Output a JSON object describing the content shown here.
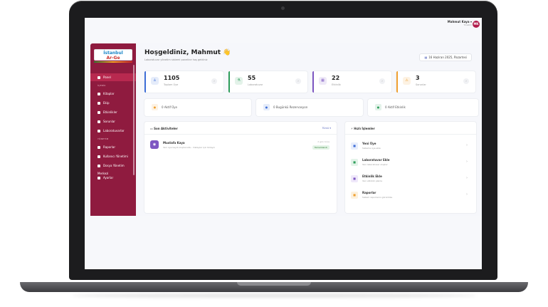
{
  "header": {
    "user_name": "Mahmut Kaya ▾",
    "user_role": "Yönetici",
    "avatar_initials": "MK"
  },
  "sidebar": {
    "logo_line1": "İstanbul",
    "logo_line2": "Ar-Ge",
    "items": [
      {
        "label": "Panel",
        "active": true
      },
      {
        "section": "İÇERİK"
      },
      {
        "label": "Kitaplar"
      },
      {
        "label": "Ekip"
      },
      {
        "label": "Etkinlikler"
      },
      {
        "label": "Sorunlar"
      },
      {
        "label": "Laboratuvarlar"
      },
      {
        "section": "YÖNETİM"
      },
      {
        "label": "Raporlar"
      },
      {
        "label": "Kullanıcı Yönetimi"
      },
      {
        "label": "Dosya Yönetim Merkezi"
      },
      {
        "label": "Ayarlar"
      }
    ]
  },
  "main": {
    "greeting": "Hoşgeldiniz, Mahmut 👋",
    "greeting_sub": "Laboratuvar yönetim sistemi paneline hoş geldiniz",
    "date": "16 Haziran 2025, Pazartesi"
  },
  "stats": [
    {
      "value": "1105",
      "label": "Toplam Üye",
      "color": "#3f6fd8",
      "icon": "user-icon"
    },
    {
      "value": "55",
      "label": "Laboratuvar",
      "color": "#2e9e5b",
      "icon": "lab-icon"
    },
    {
      "value": "22",
      "label": "Etkinlik",
      "color": "#7e57c2",
      "icon": "calendar-icon"
    },
    {
      "value": "3",
      "label": "Sorunlar",
      "color": "#f0a030",
      "icon": "alert-icon"
    }
  ],
  "quick": [
    {
      "label": "0  Aktif Üye",
      "color": "#f0a030"
    },
    {
      "label": "0  Bugünkü Rezervasyon",
      "color": "#3f6fd8"
    },
    {
      "label": "0  Aktif Etkinlik",
      "color": "#2e9e5b"
    }
  ],
  "activity": {
    "title": "Son Aktiviteler",
    "link": "Tümü ▾",
    "item": {
      "title": "Mustafa Kaya",
      "desc": "Yeni üye kaydı oluşturuldu · Detaylar için tıklayın",
      "time": "2 gün önce",
      "badge": "Tamamlandı"
    }
  },
  "ops": {
    "title": "Hızlı İşlemler",
    "items": [
      {
        "title": "Yeni Üye",
        "desc": "Sisteme üye ekle",
        "color": "#3f6fd8",
        "bg": "#e8eefc"
      },
      {
        "title": "Laboratuvar Ekle",
        "desc": "Yeni laboratuvar oluştur",
        "color": "#2e9e5b",
        "bg": "#e3f3e9"
      },
      {
        "title": "Etkinlik Ekle",
        "desc": "Yeni etkinlik planla",
        "color": "#7e57c2",
        "bg": "#efe8fa"
      },
      {
        "title": "Raporlar",
        "desc": "Sistem raporlarını görüntüle",
        "color": "#f0a030",
        "bg": "#fdf1dd"
      }
    ]
  }
}
